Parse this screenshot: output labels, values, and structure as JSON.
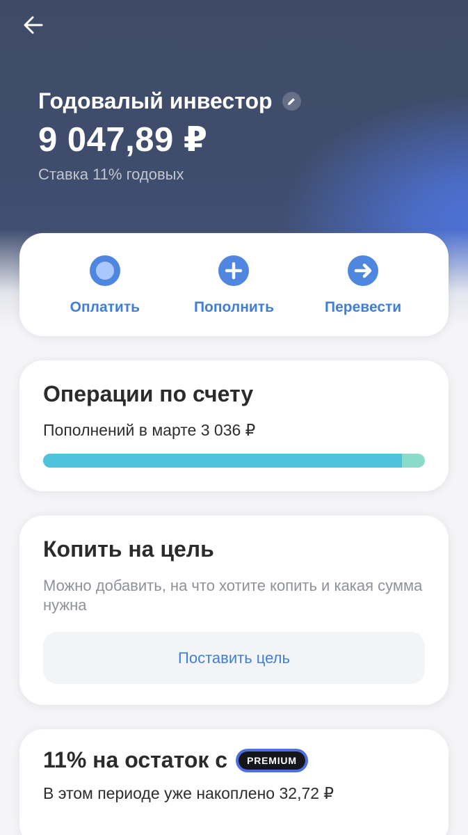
{
  "header": {
    "back_icon": "arrow-left-icon",
    "account_name": "Годовалый инвестор",
    "edit_icon": "pencil-icon",
    "balance": "9 047,89 ₽",
    "rate": "Ставка 11% годовых"
  },
  "actions": [
    {
      "label": "Оплатить",
      "icon": "circle-dot-icon"
    },
    {
      "label": "Пополнить",
      "icon": "plus-icon"
    },
    {
      "label": "Перевести",
      "icon": "arrow-right-icon"
    }
  ],
  "operations": {
    "title": "Операции по счету",
    "summary": "Пополнений в марте 3 036 ₽",
    "progress_fraction": 0.94,
    "colors": {
      "primary": "#4fc3dc",
      "secondary": "#8adbc9"
    }
  },
  "goal": {
    "title": "Копить на цель",
    "description": "Можно добавить, на что хотите копить и какая сумма нужна",
    "button_label": "Поставить цель"
  },
  "interest": {
    "title": "11% на остаток с",
    "badge": "PREMIUM",
    "accrued": "В этом периоде уже накоплено 32,72 ₽"
  },
  "colors": {
    "accent": "#3f7fd8",
    "icon_bg": "#4f86e0",
    "header_bg": "#3f4b66"
  }
}
